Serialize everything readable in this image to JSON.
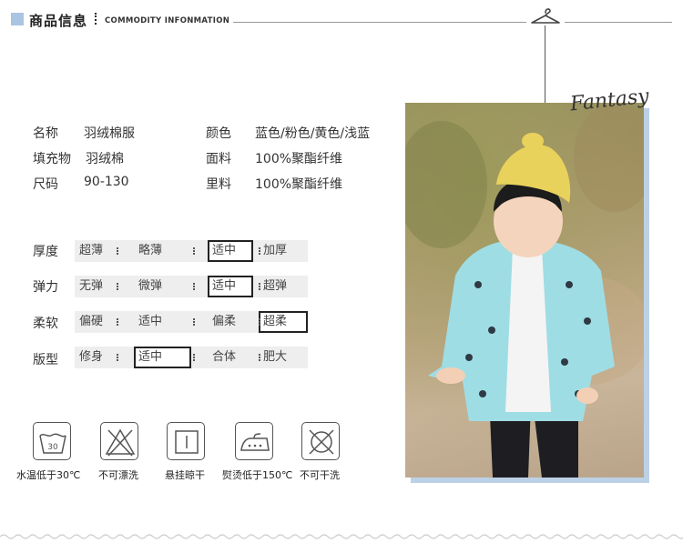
{
  "header": {
    "title": "商品信息",
    "subtitle": "COMMODITY INFONMATION"
  },
  "photo": {
    "tag": "Fantasy"
  },
  "specs": [
    {
      "label": "名称",
      "value": "羽绒棉服"
    },
    {
      "label": "颜色",
      "value": "蓝色/粉色/黄色/浅蓝"
    },
    {
      "label": "填充物",
      "value": "羽绒棉"
    },
    {
      "label": "面料",
      "value": "100%聚酯纤维"
    },
    {
      "label": "尺码",
      "value": "90-130"
    },
    {
      "label": "里料",
      "value": "100%聚酯纤维"
    }
  ],
  "attributes": [
    {
      "label": "厚度",
      "options": [
        "超薄",
        "略薄",
        "适中",
        "加厚"
      ],
      "selected": "适中"
    },
    {
      "label": "弹力",
      "options": [
        "无弹",
        "微弹",
        "适中",
        "超弹"
      ],
      "selected": "适中"
    },
    {
      "label": "柔软",
      "options": [
        "偏硬",
        "适中",
        "偏柔",
        "超柔"
      ],
      "selected": "超柔"
    },
    {
      "label": "版型",
      "options": [
        "修身",
        "适中",
        "合体",
        "肥大"
      ],
      "selected": "适中"
    }
  ],
  "care": [
    {
      "icon": "wash-30-icon",
      "label": "水温低于30℃",
      "badge": "30"
    },
    {
      "icon": "no-bleach-icon",
      "label": "不可漂洗"
    },
    {
      "icon": "hang-dry-icon",
      "label": "悬挂晾干"
    },
    {
      "icon": "iron-icon",
      "label": "熨烫低于150℃"
    },
    {
      "icon": "no-dry-clean-icon",
      "label": "不可干洗"
    }
  ],
  "colors": {
    "accent": "#a9c5e2",
    "selected_border": "#222222",
    "option_bar": "#eeeeee"
  }
}
